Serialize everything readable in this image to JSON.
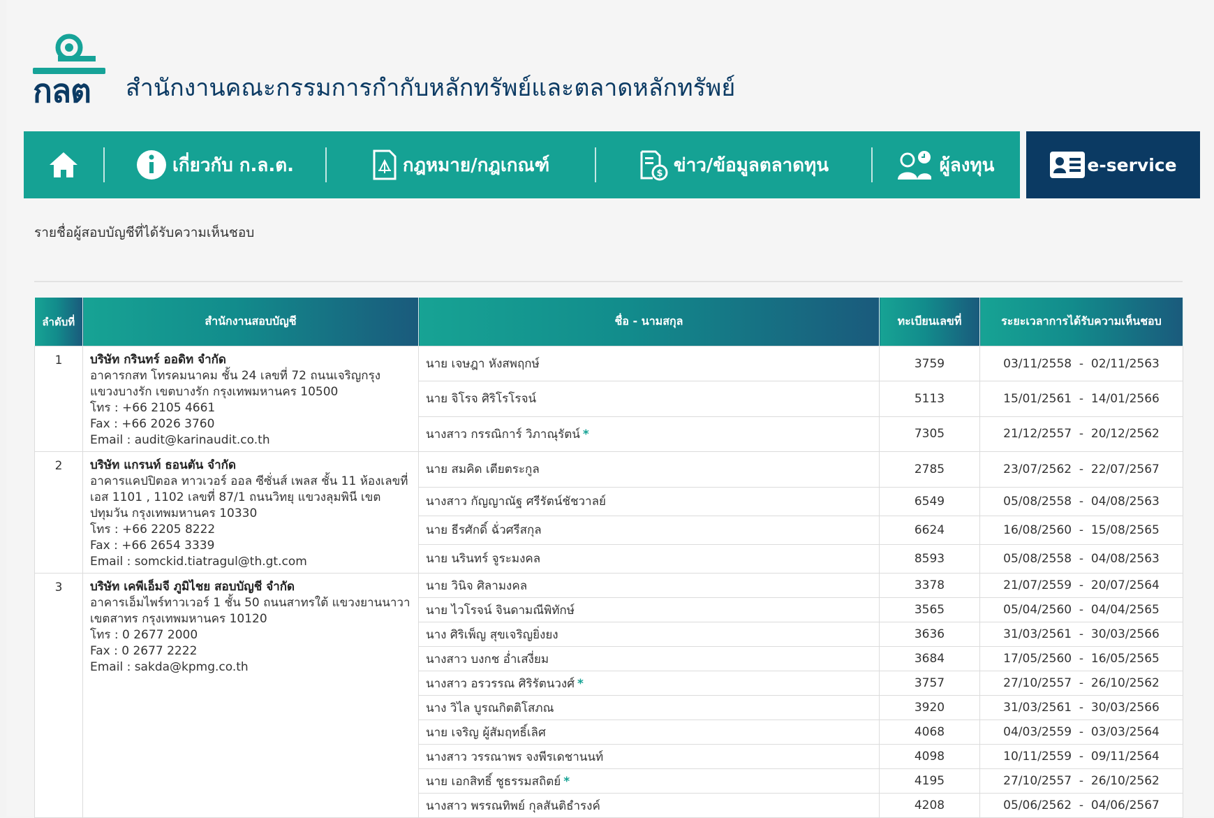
{
  "header": {
    "logo_text": "กลต",
    "org_title": "สำนักงานคณะกรรมการกำกับหลักทรัพย์และตลาดหลักทรัพย์"
  },
  "nav": {
    "home_icon": "home-icon",
    "items": [
      {
        "label": "เกี่ยวกับ ก.ล.ต.",
        "icon": "info-icon"
      },
      {
        "label": "กฎหมาย/กฎเกณฑ์",
        "icon": "law-document-icon"
      },
      {
        "label": "ข่าว/ข้อมูลตลาดทุน",
        "icon": "news-money-icon"
      },
      {
        "label": "ผู้ลงทุน",
        "icon": "investor-icon"
      }
    ],
    "eservice": {
      "label": "e-service",
      "icon": "id-card-icon"
    },
    "colors": {
      "primary": "#15a294",
      "dark": "#0b3a63"
    }
  },
  "page_title": "รายชื่อผู้สอบบัญชีที่ได้รับความเห็นชอบ",
  "table": {
    "headers": [
      "ลำดับที่",
      "สำนักงานสอบบัญชี",
      "ชื่อ - นามสกุล",
      "ทะเบียนเลขที่",
      "ระยะเวลาการได้รับความเห็นชอบ"
    ],
    "firms": [
      {
        "no": "1",
        "name": "บริษัท กรินทร์ ออดิท จำกัด",
        "address": "อาคารกสท โทรคมนาคม ชั้น 24 เลขที่ 72 ถนนเจริญกรุง แขวงบางรัก เขตบางรัก กรุงเทพมหานคร 10500",
        "phone": "โทร : +66 2105 4661",
        "fax": "Fax : +66 2026 3760",
        "email": "Email : audit@karinaudit.co.th",
        "auditors": [
          {
            "name": "นาย เจษฎา หังสพฤกษ์",
            "reg": "3759",
            "period": "03/11/2558  -  02/11/2563",
            "star": ""
          },
          {
            "name": "นาย จิโรจ ศิริโรโรจน์",
            "reg": "5113",
            "period": "15/01/2561  -  14/01/2566",
            "star": ""
          },
          {
            "name": "นางสาว กรรณิการ์ วิภาณุรัตน์",
            "reg": "7305",
            "period": "21/12/2557  -  20/12/2562",
            "star": "*"
          }
        ]
      },
      {
        "no": "2",
        "name": "บริษัท แกรนท์ ธอนตัน จำกัด",
        "address": "อาคารแคปปิตอล ทาวเวอร์ ออล ซีซั่นส์ เพลส ชั้น 11 ห้องเลขที่ เอส 1101 , 1102 เลขที่ 87/1 ถนนวิทยุ แขวงลุมพินี เขตปทุมวัน กรุงเทพมหานคร 10330",
        "phone": "โทร : +66 2205 8222",
        "fax": "Fax : +66 2654 3339",
        "email": "Email : somckid.tiatragul@th.gt.com",
        "auditors": [
          {
            "name": "นาย สมคิด เตียตระกูล",
            "reg": "2785",
            "period": "23/07/2562  -  22/07/2567",
            "star": ""
          },
          {
            "name": "นางสาว กัญญาณัฐ ศรีรัตน์ชัชวาลย์",
            "reg": "6549",
            "period": "05/08/2558  -  04/08/2563",
            "star": ""
          },
          {
            "name": "นาย ธีรศักดิ์ ฉั่วศรีสกุล",
            "reg": "6624",
            "period": "16/08/2560  -  15/08/2565",
            "star": ""
          },
          {
            "name": "นาย นรินทร์ จูระมงคล",
            "reg": "8593",
            "period": "05/08/2558  -  04/08/2563",
            "star": ""
          }
        ]
      },
      {
        "no": "3",
        "name": "บริษัท เคพีเอ็มจี ภูมิไชย สอบบัญชี จำกัด",
        "address": "อาคารเอ็มไพร์ทาวเวอร์ 1 ชั้น 50 ถนนสาทรใต้ แขวงยานนาวา เขตสาทร กรุงเทพมหานคร 10120",
        "phone": "โทร : 0 2677 2000",
        "fax": "Fax : 0 2677 2222",
        "email": "Email : sakda@kpmg.co.th",
        "auditors": [
          {
            "name": "นาย วินิจ ศิลามงคล",
            "reg": "3378",
            "period": "21/07/2559  -  20/07/2564",
            "star": ""
          },
          {
            "name": "นาย ไวโรจน์ จินดามณีพิทักษ์",
            "reg": "3565",
            "period": "05/04/2560  -  04/04/2565",
            "star": ""
          },
          {
            "name": "นาง ศิริเพ็ญ สุขเจริญยิ่งยง",
            "reg": "3636",
            "period": "31/03/2561  -  30/03/2566",
            "star": ""
          },
          {
            "name": "นางสาว บงกช อ่ำเสงี่ยม",
            "reg": "3684",
            "period": "17/05/2560  -  16/05/2565",
            "star": ""
          },
          {
            "name": "นางสาว อรวรรณ ศิริรัตนวงศ์",
            "reg": "3757",
            "period": "27/10/2557  -  26/10/2562",
            "star": "*"
          },
          {
            "name": "นาง วิไล บูรณกิตติโสภณ",
            "reg": "3920",
            "period": "31/03/2561  -  30/03/2566",
            "star": ""
          },
          {
            "name": "นาย เจริญ ผู้สัมฤทธิ์เลิศ",
            "reg": "4068",
            "period": "04/03/2559  -  03/03/2564",
            "star": ""
          },
          {
            "name": "นางสาว วรรณาพร จงพีรเดชานนท์",
            "reg": "4098",
            "period": "10/11/2559  -  09/11/2564",
            "star": ""
          },
          {
            "name": "นาย เอกสิทธิ์ ชูธรรมสถิตย์",
            "reg": "4195",
            "period": "27/10/2557  -  26/10/2562",
            "star": "*"
          },
          {
            "name": "นางสาว พรรณทิพย์ กุลสันติธำรงค์",
            "reg": "4208",
            "period": "05/06/2562  -  04/06/2567",
            "star": ""
          }
        ]
      }
    ]
  }
}
